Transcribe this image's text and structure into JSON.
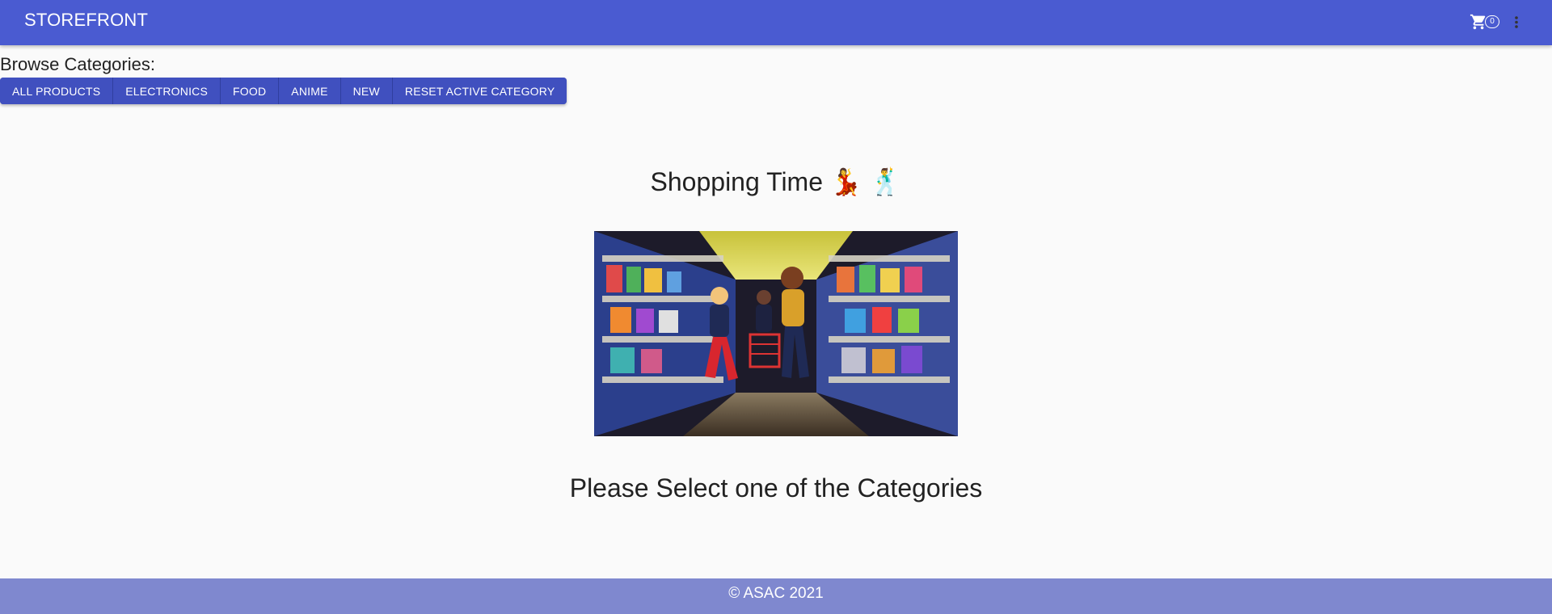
{
  "appbar": {
    "title": "STOREFRONT",
    "cart_count": "0",
    "cart_icon": "shopping-cart-icon",
    "more_icon": "more-vert-icon",
    "background": "#4a5bd1"
  },
  "categories": {
    "label": "Browse Categories:",
    "buttons": [
      "ALL PRODUCTS",
      "ELECTRONICS",
      "FOOD",
      "ANIME",
      "NEW",
      "RESET ACTIVE CATEGORY"
    ],
    "button_color": "#3f51b5"
  },
  "main": {
    "title": "Shopping Time 💃 🕺",
    "image_description_icon": "supermarket-dance-gif",
    "prompt": "Please Select one of the Categories"
  },
  "footer": {
    "text": "© ASAC 2021",
    "background": "#7f88cf"
  }
}
